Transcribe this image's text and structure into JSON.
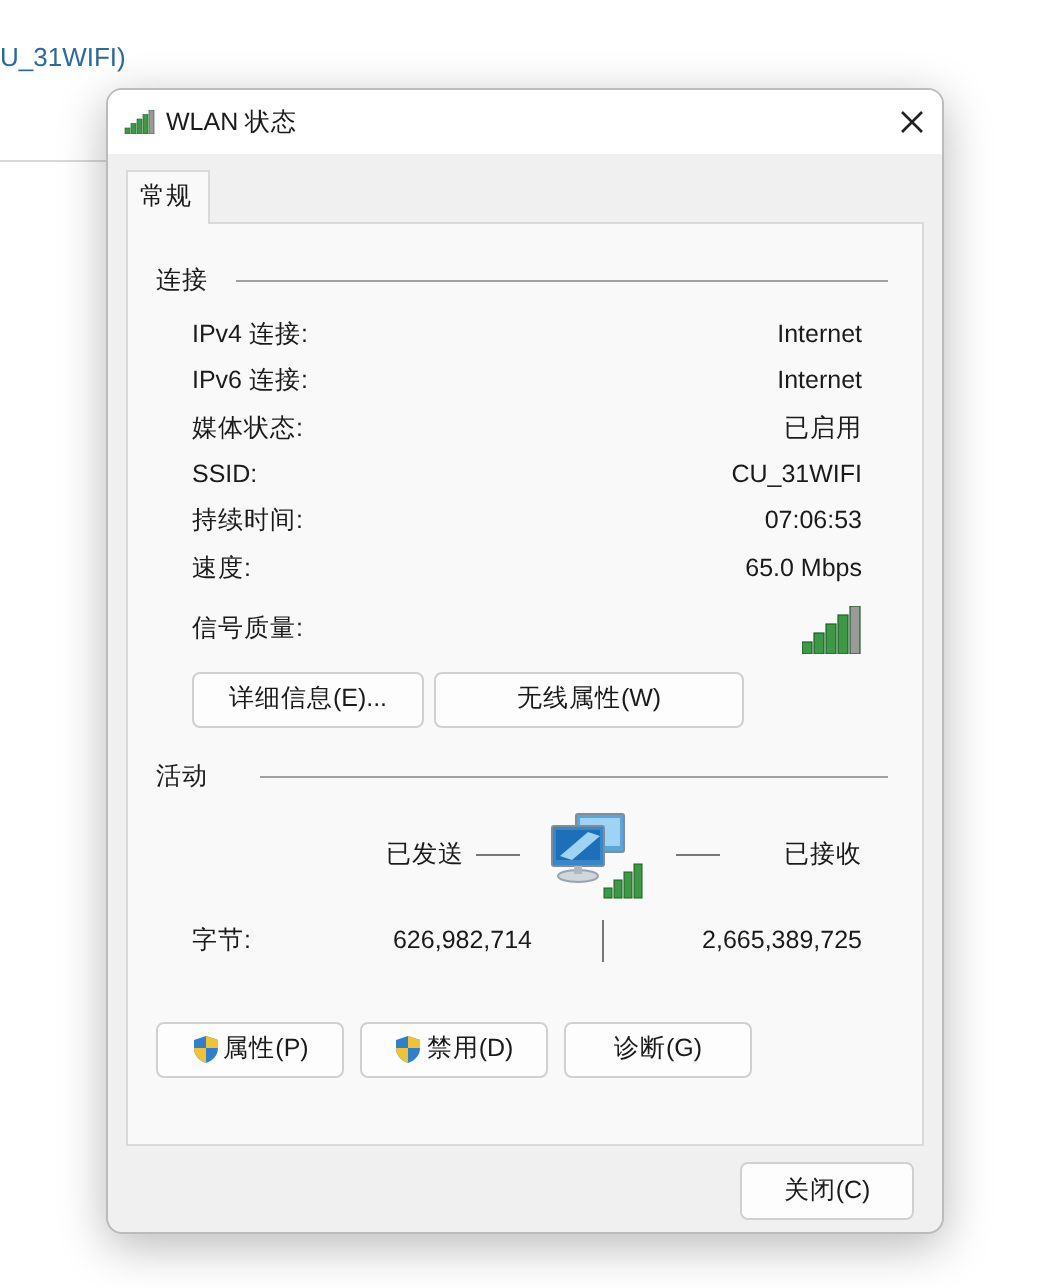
{
  "background": {
    "text": "U_31WIFI)"
  },
  "window": {
    "title": "WLAN 状态"
  },
  "tabs": [
    {
      "label": "常规",
      "selected": true
    }
  ],
  "connection": {
    "heading": "连接",
    "rows": [
      {
        "label": "IPv4 连接:",
        "value": "Internet"
      },
      {
        "label": "IPv6 连接:",
        "value": "Internet"
      },
      {
        "label": "媒体状态:",
        "value": "已启用"
      },
      {
        "label": "SSID:",
        "value": "CU_31WIFI"
      },
      {
        "label": "持续时间:",
        "value": "07:06:53"
      },
      {
        "label": "速度:",
        "value": "65.0 Mbps"
      }
    ],
    "signal_label": "信号质量:"
  },
  "connection_buttons": [
    "详细信息(E)...",
    "无线属性(W)"
  ],
  "activity": {
    "heading": "活动",
    "sent_label": "已发送",
    "received_label": "已接收",
    "bytes_label": "字节:",
    "bytes_sent": "626,982,714",
    "bytes_received": "2,665,389,725"
  },
  "activity_buttons": [
    {
      "label": "属性(P)",
      "shield": true
    },
    {
      "label": "禁用(D)",
      "shield": true
    },
    {
      "label": "诊断(G)",
      "shield": false
    }
  ],
  "close_button": "关闭(C)"
}
